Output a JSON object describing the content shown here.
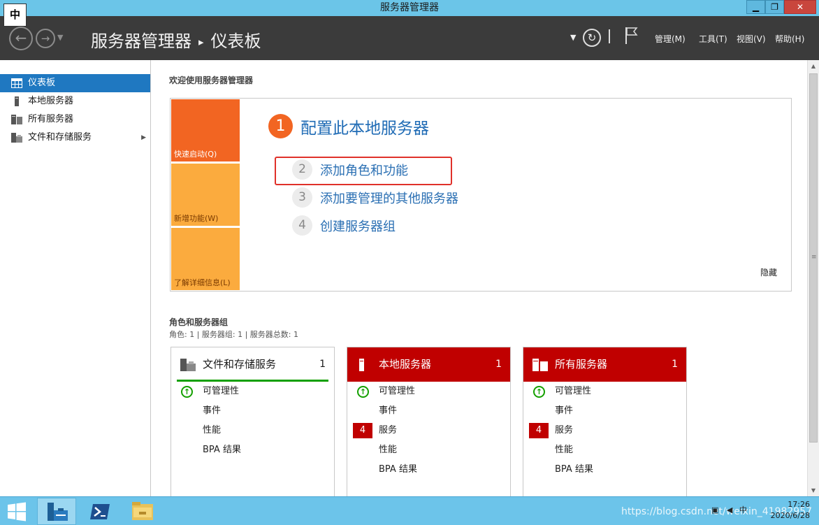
{
  "window": {
    "title": "服务器管理器"
  },
  "ime": {
    "label": "中"
  },
  "window_buttons": {
    "minimize": "▁",
    "maximize": "❐",
    "close": "✕"
  },
  "header": {
    "breadcrumb_root": "服务器管理器",
    "breadcrumb_sep": "▸",
    "breadcrumb_page": "仪表板",
    "menus": [
      "管理(M)",
      "工具(T)",
      "视图(V)",
      "帮助(H)"
    ]
  },
  "sidebar": {
    "items": [
      {
        "label": "仪表板",
        "icon": "dashboard-icon",
        "active": true
      },
      {
        "label": "本地服务器",
        "icon": "server-icon"
      },
      {
        "label": "所有服务器",
        "icon": "servers-icon"
      },
      {
        "label": "文件和存储服务",
        "icon": "file-storage-icon",
        "expandable": true
      }
    ]
  },
  "main": {
    "welcome_title": "欢迎使用服务器管理器",
    "quickstart": {
      "tiles": [
        "快速启动(Q)",
        "新增功能(W)",
        "了解详细信息(L)"
      ],
      "steps": [
        {
          "num": "1",
          "label": "配置此本地服务器"
        },
        {
          "num": "2",
          "label": "添加角色和功能"
        },
        {
          "num": "3",
          "label": "添加要管理的其他服务器"
        },
        {
          "num": "4",
          "label": "创建服务器组"
        }
      ],
      "hide_label": "隐藏"
    },
    "roles": {
      "title": "角色和服务器组",
      "subtitle": "角色: 1 | 服务器组: 1 | 服务器总数: 1",
      "cards": [
        {
          "title": "文件和存储服务",
          "count": "1",
          "rows": [
            "可管理性",
            "事件",
            "性能",
            "BPA 结果"
          ]
        },
        {
          "title": "本地服务器",
          "count": "1",
          "badge": "4",
          "rows": [
            "可管理性",
            "事件",
            "服务",
            "性能",
            "BPA 结果"
          ]
        },
        {
          "title": "所有服务器",
          "count": "1",
          "badge": "4",
          "rows": [
            "可管理性",
            "事件",
            "服务",
            "性能",
            "BPA 结果"
          ]
        }
      ]
    }
  },
  "taskbar": {
    "watermark": "https://blog.csdn.net/weixin_41982957",
    "tray_ime": "中",
    "time": "17:26",
    "date": "2020/6/28"
  },
  "colors": {
    "accent": "#1f78c1",
    "header_bg": "#3b3b3b",
    "quickstart_orange": "#f26522",
    "quickstart_yellow": "#fbab3e",
    "alert_red": "#c00000",
    "ok_green": "#14a000",
    "taskbar": "#6cc4ea"
  }
}
